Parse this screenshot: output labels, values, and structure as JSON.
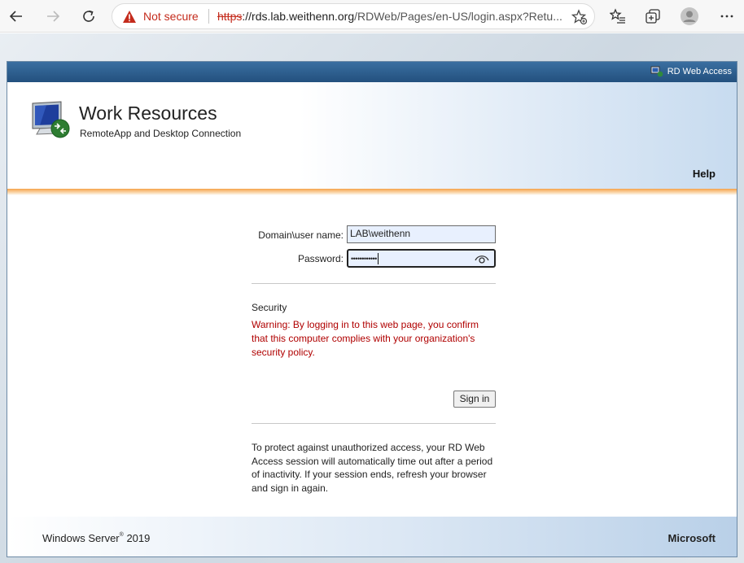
{
  "browser": {
    "security_label": "Not secure",
    "url_scheme": "https",
    "url_rest_host": "://rds.lab.weithenn.org",
    "url_path": "/RDWeb/Pages/en-US/login.aspx?Retu..."
  },
  "rdweb": {
    "top_link": "RD Web Access",
    "title": "Work Resources",
    "subtitle": "RemoteApp and Desktop Connection",
    "help_label": "Help",
    "footer_product": "Windows Server",
    "footer_version": "2019",
    "footer_brand": "Microsoft"
  },
  "login": {
    "username_label": "Domain\\user name:",
    "username_value": "LAB\\weithenn",
    "password_label": "Password:",
    "password_mask": "••••••••••••",
    "security_heading": "Security",
    "warning_text": "Warning: By logging in to this web page, you confirm that this computer complies with your organization's security policy.",
    "signin_label": "Sign in",
    "timeout_info": "To protect against unauthorized access, your RD Web Access session will automatically time out after a period of inactivity. If your session ends, refresh your browser and sign in again."
  },
  "colors": {
    "warning": "#b00000",
    "header_accent": "#f5a34a",
    "topbar": "#23507e"
  }
}
